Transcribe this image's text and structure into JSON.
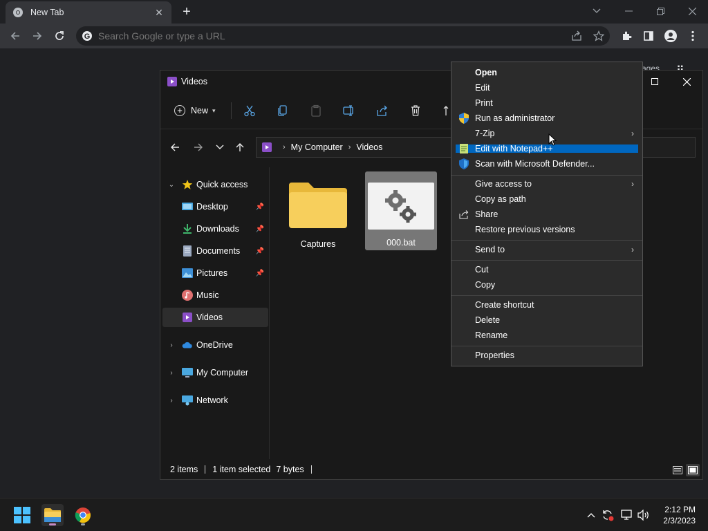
{
  "browser": {
    "tab_title": "New Tab",
    "omnibox_placeholder": "Search Google or type a URL"
  },
  "background": {
    "images_link": "ages"
  },
  "explorer": {
    "title": "Videos",
    "command_bar": {
      "new_label": "New"
    },
    "breadcrumb": [
      "My Computer",
      "Videos"
    ],
    "sidebar": {
      "quick_access": "Quick access",
      "quick_items": [
        {
          "label": "Desktop",
          "icon": "desktop-icon"
        },
        {
          "label": "Downloads",
          "icon": "downloads-icon"
        },
        {
          "label": "Documents",
          "icon": "documents-icon"
        },
        {
          "label": "Pictures",
          "icon": "pictures-icon"
        },
        {
          "label": "Music",
          "icon": "music-icon"
        },
        {
          "label": "Videos",
          "icon": "videos-icon"
        }
      ],
      "onedrive": "OneDrive",
      "my_computer": "My Computer",
      "network": "Network"
    },
    "files": [
      {
        "name": "Captures",
        "type": "folder"
      },
      {
        "name": "000.bat",
        "type": "batch-file",
        "selected": true
      }
    ],
    "status": {
      "items": "2 items",
      "selection": "1 item selected",
      "size": "7 bytes"
    }
  },
  "context_menu": {
    "open": "Open",
    "edit": "Edit",
    "print": "Print",
    "run_as_admin": "Run as administrator",
    "zip": "7-Zip",
    "notepad": "Edit with Notepad++",
    "defender": "Scan with Microsoft Defender...",
    "give_access": "Give access to",
    "copy_path": "Copy as path",
    "share": "Share",
    "restore": "Restore previous versions",
    "send_to": "Send to",
    "cut": "Cut",
    "copy": "Copy",
    "create_shortcut": "Create shortcut",
    "delete": "Delete",
    "rename": "Rename",
    "properties": "Properties",
    "highlight_color": "#0067c0"
  },
  "taskbar": {
    "time": "2:12 PM",
    "date": "2/3/2023"
  }
}
